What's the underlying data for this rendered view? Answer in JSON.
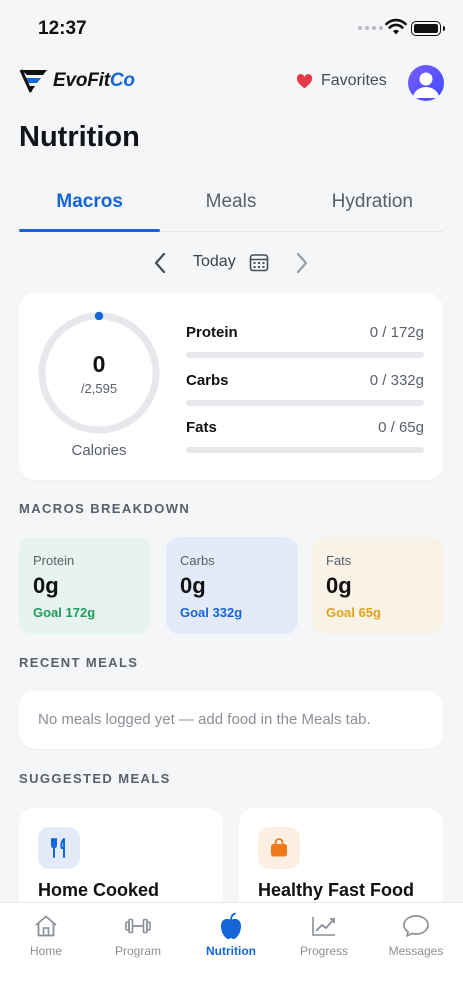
{
  "status": {
    "time": "12:37"
  },
  "brand": {
    "name_part1": "EvoFit",
    "name_part2": "Co"
  },
  "header": {
    "favorites_label": "Favorites"
  },
  "page": {
    "title": "Nutrition"
  },
  "tabs": [
    {
      "label": "Macros",
      "active": true
    },
    {
      "label": "Meals",
      "active": false
    },
    {
      "label": "Hydration",
      "active": false
    }
  ],
  "date_nav": {
    "label": "Today"
  },
  "calories": {
    "value": "0",
    "goal": "/2,595",
    "label": "Calories",
    "progress_fraction": 0
  },
  "macros": [
    {
      "name": "Protein",
      "value": "0 / 172g",
      "progress_fraction": 0
    },
    {
      "name": "Carbs",
      "value": "0 / 332g",
      "progress_fraction": 0
    },
    {
      "name": "Fats",
      "value": "0 / 65g",
      "progress_fraction": 0
    }
  ],
  "breakdown": {
    "section_label": "MACROS BREAKDOWN",
    "tiles": [
      {
        "name": "Protein",
        "value": "0g",
        "goal": "Goal 172g",
        "bg": "#e6f3ee",
        "goal_color": "#1f9d5c"
      },
      {
        "name": "Carbs",
        "value": "0g",
        "goal": "Goal 332g",
        "bg": "#e3ebfa",
        "goal_color": "#1565d8"
      },
      {
        "name": "Fats",
        "value": "0g",
        "goal": "Goal 65g",
        "bg": "#f8f3e6",
        "goal_color": "#e3a21a"
      }
    ]
  },
  "recent_meals": {
    "section_label": "RECENT MEALS",
    "empty_text": "No meals logged yet — add food in the Meals tab."
  },
  "suggested_meals": {
    "section_label": "SUGGESTED MEALS",
    "items": [
      {
        "title": "Home Cooked",
        "icon": "fork-knife-icon",
        "icon_bg": "#e3ebfa",
        "icon_color": "#1565d8"
      },
      {
        "title": "Healthy Fast Food",
        "icon": "bag-icon",
        "icon_bg": "#fdeee2",
        "icon_color": "#f07a1a"
      }
    ]
  },
  "bottom_nav": [
    {
      "label": "Home",
      "icon": "home-icon",
      "active": false
    },
    {
      "label": "Program",
      "icon": "dumbbell-icon",
      "active": false
    },
    {
      "label": "Nutrition",
      "icon": "apple-icon",
      "active": true
    },
    {
      "label": "Progress",
      "icon": "chart-icon",
      "active": false
    },
    {
      "label": "Messages",
      "icon": "chat-icon",
      "active": false
    }
  ],
  "colors": {
    "accent": "#1565d8",
    "favorite": "#e53945"
  }
}
